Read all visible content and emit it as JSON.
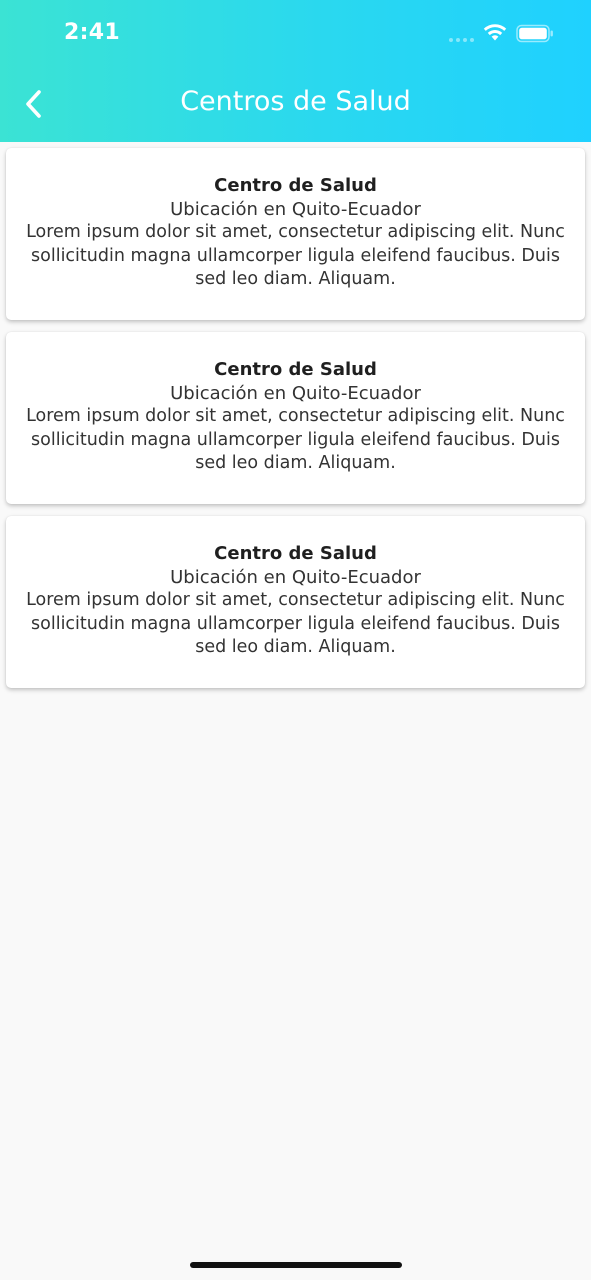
{
  "status_bar": {
    "time": "2:41"
  },
  "header": {
    "title": "Centros de Salud",
    "back_icon": "chevron-left-icon",
    "gradient_start": "#3be3d4",
    "gradient_end": "#1fd1ff"
  },
  "cards": [
    {
      "title": "Centro de Salud",
      "location": "Ubicación en Quito-Ecuador",
      "description": "Lorem ipsum dolor sit amet, consectetur adipiscing elit. Nunc sollicitudin magna ullamcorper ligula eleifend faucibus. Duis sed leo diam. Aliquam."
    },
    {
      "title": "Centro de Salud",
      "location": "Ubicación en Quito-Ecuador",
      "description": "Lorem ipsum dolor sit amet, consectetur adipiscing elit. Nunc sollicitudin magna ullamcorper ligula eleifend faucibus. Duis sed leo diam. Aliquam."
    },
    {
      "title": "Centro de Salud",
      "location": "Ubicación en Quito-Ecuador",
      "description": "Lorem ipsum dolor sit amet, consectetur adipiscing elit. Nunc sollicitudin magna ullamcorper ligula eleifend faucibus. Duis sed leo diam. Aliquam."
    }
  ]
}
